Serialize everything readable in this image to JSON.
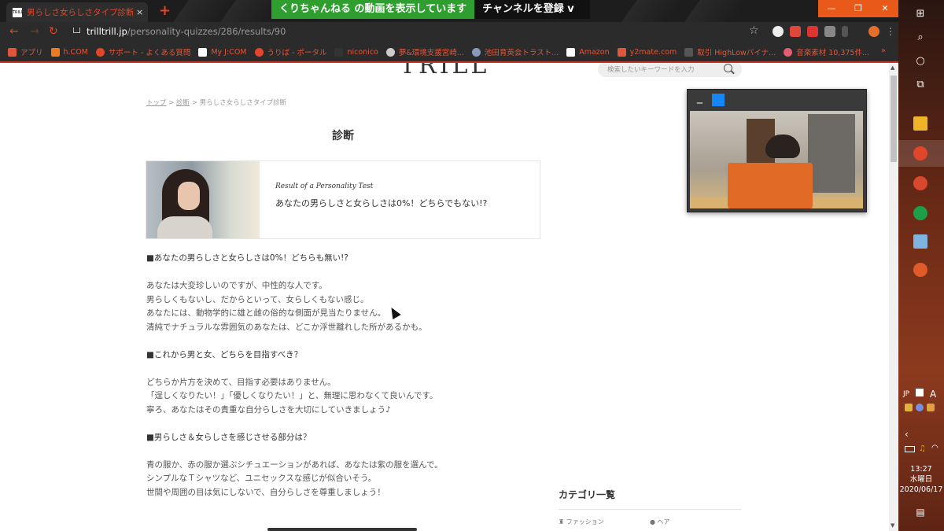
{
  "browser": {
    "tab_title": "男らしさ女らしさタイプ診断 | TRILL [",
    "tab_favicon": "TRILL",
    "tab_close": "×",
    "new_tab": "+",
    "url_domain": "trilltrill.jp",
    "url_path": "/personality-quizzes/286/results/90",
    "window_buttons": [
      "—",
      "❐",
      "✕"
    ],
    "youtube_bar_text": "くりちゃんねる の動画を表示しています",
    "youtube_subscribe": "チャンネルを登録 v",
    "bookmarks": [
      {
        "label": "アプリ",
        "color": "#e0563a"
      },
      {
        "label": "h.COM",
        "color": "#f07a20"
      },
      {
        "label": "サポート - よくある質問",
        "color": "#e0462a"
      },
      {
        "label": "My J:COM",
        "color": "#ffffff"
      },
      {
        "label": "うりば - ポータル",
        "color": "#e0462a"
      },
      {
        "label": "niconico",
        "color": "#333333"
      },
      {
        "label": "夢&環境支援宮崎...",
        "color": "#cccccc"
      },
      {
        "label": "池田育英会トラスト...",
        "color": "#8899bb"
      },
      {
        "label": "Amazon",
        "color": "#ffffff"
      },
      {
        "label": "y2mate.com",
        "color": "#e0563a"
      },
      {
        "label": "取引 HighLowバイナ...",
        "color": "#555555"
      },
      {
        "label": "音楽素材 10,375件...",
        "color": "#e06070"
      }
    ],
    "bookmarks_more": "»"
  },
  "page": {
    "logo": "TRILL",
    "search_placeholder": "検索したいキーワードを入力",
    "breadcrumb": {
      "home": "トップ",
      "sep1": " > ",
      "quiz": "診断",
      "sep2": " > ",
      "current": "男らしさ女らしさタイプ診断"
    },
    "heading": "診断",
    "result_subtitle": "Result of a Personality Test",
    "result_title": "あなたの男らしさと女らしさは0%！どちらでもない!?",
    "body": [
      {
        "type": "h",
        "text": "■あなたの男らしさと女らしさは0%！どちらも無い!?"
      },
      {
        "type": "gap",
        "text": ""
      },
      {
        "type": "p",
        "text": "あなたは大変珍しいのですが、中性的な人です。"
      },
      {
        "type": "p",
        "text": "男らしくもないし、だからといって、女らしくもない感じ。"
      },
      {
        "type": "p",
        "text": "あなたには、動物学的に雄と雌の俗的な側面が見当たりません。"
      },
      {
        "type": "p",
        "text": "清純でナチュラルな雰囲気のあなたは、どこか浮世離れした所があるかも。"
      },
      {
        "type": "gap",
        "text": ""
      },
      {
        "type": "h",
        "text": "■これから男と女、どちらを目指すべき？"
      },
      {
        "type": "gap",
        "text": ""
      },
      {
        "type": "p",
        "text": "どちらか片方を決めて、目指す必要はありません。"
      },
      {
        "type": "p",
        "text": "「逞しくなりたい！」「優しくなりたい！」と、無理に思わなくて良いんです。"
      },
      {
        "type": "p",
        "text": "寧ろ、あなたはその貴重な自分らしさを大切にしていきましょう♪"
      },
      {
        "type": "gap",
        "text": ""
      },
      {
        "type": "h",
        "text": "■男らしさ＆女らしさを感じさせる部分は？"
      },
      {
        "type": "gap",
        "text": ""
      },
      {
        "type": "p",
        "text": "青の服か、赤の服か選ぶシチュエーションがあれば、あなたは紫の服を選んで。"
      },
      {
        "type": "p",
        "text": "シンプルなＴシャツなど、ユニセックスな感じが似合いそう。"
      },
      {
        "type": "p",
        "text": "世間や周囲の目は気にしないで、自分らしさを尊重しましょう！"
      }
    ],
    "category_title": "カテゴリ一覧",
    "categories": [
      "ファッション",
      "ヘア"
    ]
  },
  "webcam": {
    "minimize": "_"
  },
  "taskbar": {
    "lang": "JP",
    "ime": "A",
    "time": "13:27",
    "weekday": "水曜日",
    "date": "2020/06/17"
  }
}
